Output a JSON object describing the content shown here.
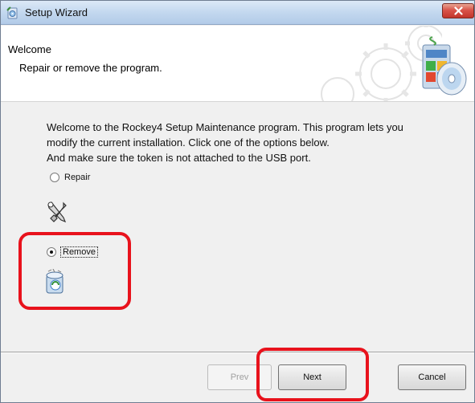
{
  "window": {
    "title": "Setup Wizard"
  },
  "header": {
    "title": "Welcome",
    "subtitle": "Repair or remove the program."
  },
  "content": {
    "intro_lines": [
      "Welcome to the Rockey4 Setup Maintenance program. This program lets you",
      "modify the current installation. Click one of the options below.",
      "And make sure the token is not attached to the USB port."
    ],
    "options": [
      {
        "label": "Repair",
        "selected": false,
        "icon": "tools-icon"
      },
      {
        "label": "Remove",
        "selected": true,
        "icon": "remove-program-icon"
      }
    ]
  },
  "buttons": {
    "prev": "Prev",
    "next": "Next",
    "cancel": "Cancel"
  },
  "colors": {
    "highlight": "#e8121c",
    "titlebar": "#c3d8ef",
    "close": "#d9544a"
  }
}
